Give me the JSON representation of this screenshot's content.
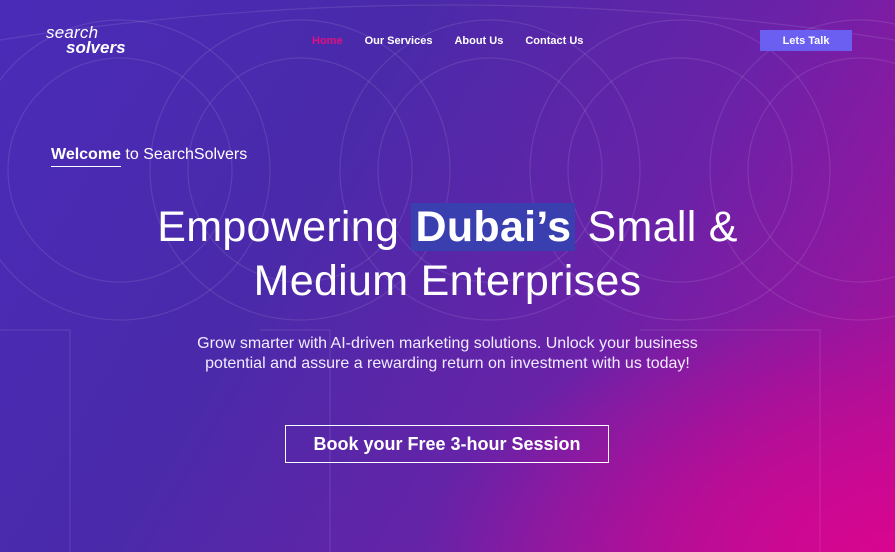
{
  "brand": {
    "logo_line1": "search",
    "logo_line2": "solvers"
  },
  "nav": {
    "items": [
      {
        "label": "Home",
        "active": true
      },
      {
        "label": "Our Services",
        "active": false
      },
      {
        "label": "About Us",
        "active": false
      },
      {
        "label": "Contact Us",
        "active": false
      }
    ],
    "cta_label": "Lets Talk"
  },
  "hero": {
    "welcome_strong": "Welcome",
    "welcome_rest": "to SearchSolvers",
    "headline_part1": "Empowering",
    "headline_highlight": "Dubai’s",
    "headline_part2": "Small &",
    "headline_line2": "Medium Enterprises",
    "subtext": "Grow smarter with AI-driven marketing solutions. Unlock your business potential and assure a rewarding return on investment with us today!",
    "cta_label": "Book your Free 3-hour Session"
  },
  "colors": {
    "accent_nav_active": "#e0107e",
    "cta_top_bg": "#6a5ff1",
    "headline_highlight_bg": "#3a3fb0",
    "bg_start": "#4a2bb8",
    "bg_end": "#d8058f"
  }
}
